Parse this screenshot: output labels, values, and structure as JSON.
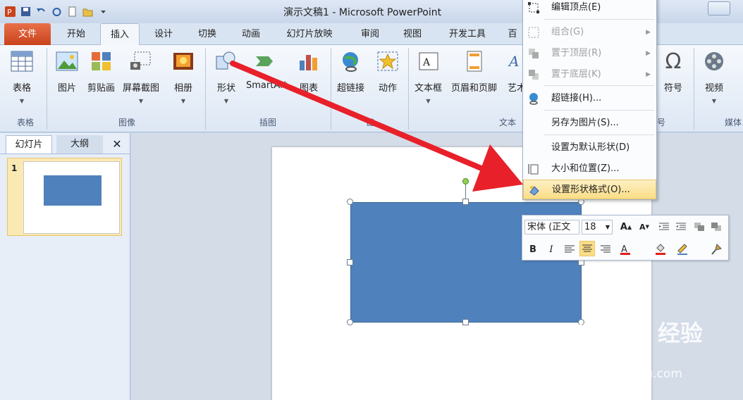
{
  "window": {
    "title": "演示文稿1 - Microsoft PowerPoint"
  },
  "tabs": {
    "file": "文件",
    "home": "开始",
    "insert": "插入",
    "design": "设计",
    "transitions": "切换",
    "animations": "动画",
    "slideshow": "幻灯片放映",
    "review": "审阅",
    "view": "视图",
    "developer": "开发工具",
    "addins": "百"
  },
  "ribbon": {
    "table": "表格",
    "picture": "图片",
    "clipart": "剪贴画",
    "screenshot": "屏幕截图",
    "album": "相册",
    "shapes": "形状",
    "smartart": "SmartArt",
    "chart": "图表",
    "hyperlink": "超链接",
    "action": "动作",
    "textbox": "文本框",
    "header_footer": "页眉和页脚",
    "wordart": "艺术",
    "symbol": "符号",
    "video": "视频",
    "g_table": "表格",
    "g_images": "图像",
    "g_illus": "插图",
    "g_links": "链",
    "g_text": "文本",
    "g_symbol": "号",
    "g_media": "媒体"
  },
  "pane": {
    "slides_tab": "幻灯片",
    "outline_tab": "大纲",
    "close": "✕",
    "slide_num": "1"
  },
  "context_menu": {
    "edit_points": "编辑顶点(E)",
    "group": "组合(G)",
    "bring_front": "置于顶层(R)",
    "send_back": "置于底层(K)",
    "hyperlink": "超链接(H)...",
    "save_as_picture": "另存为图片(S)...",
    "set_default": "设置为默认形状(D)",
    "size_position": "大小和位置(Z)...",
    "format_shape": "设置形状格式(O)..."
  },
  "mini_toolbar": {
    "font": "宋体 (正文",
    "size": "18",
    "bold": "B",
    "italic": "I"
  },
  "watermark": {
    "logo": "Bai du 经验",
    "url": "jingyan.baidu.com"
  },
  "colors": {
    "shape_fill": "#4f81bd",
    "arrow": "#e8202a",
    "file_tab": "#d2532a",
    "highlight": "#fbdd86"
  }
}
